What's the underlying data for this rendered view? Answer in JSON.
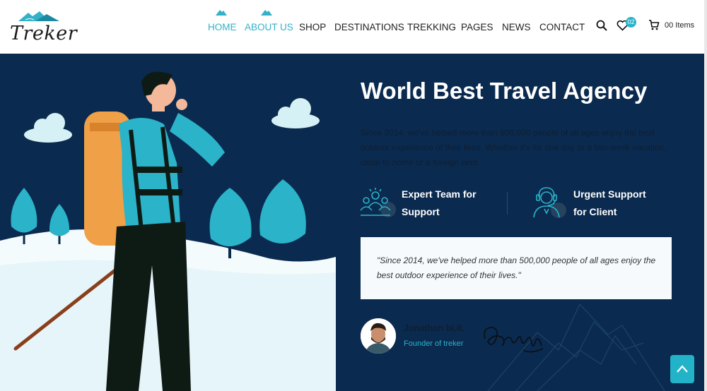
{
  "brand": {
    "logo_text": "Treker"
  },
  "nav": {
    "items": [
      {
        "label": "HOME"
      },
      {
        "label": "ABOUT US"
      },
      {
        "label": "SHOP"
      },
      {
        "label": "DESTINATIONS"
      },
      {
        "label": "TREKKING"
      },
      {
        "label": "PAGES"
      },
      {
        "label": "NEWS"
      },
      {
        "label": "CONTACT"
      }
    ]
  },
  "header_actions": {
    "wishlist_count": "02",
    "cart_label": "00 Items"
  },
  "hero": {
    "title": "World Best Travel Agency",
    "description": "Since 2014, we've helped more than 500,000 people of all ages enjoy the best outdoor experience of their lives. Whether it's for one day or a two-week vacation, close to home or a foreign land.",
    "features": [
      {
        "line1": "Expert Team for",
        "line2": "Support",
        "icon": "team-icon"
      },
      {
        "line1": "Urgent Support",
        "line2": "for Client",
        "icon": "headset-support-icon"
      }
    ],
    "quote": "\"Since 2014, we've helped more than 500,000 people of all ages enjoy the best outdoor experience of their lives.\"",
    "author_name": "Jonathon bLIL",
    "author_role": "Founder of treker"
  },
  "colors": {
    "accent": "#33b1c8",
    "hero_bg": "#0b2a4f",
    "trees": "#2bb3c9",
    "backpack": "#f0a047"
  }
}
